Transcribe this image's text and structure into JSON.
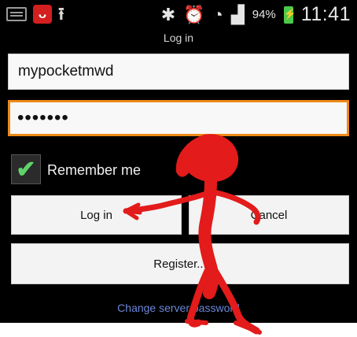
{
  "status_bar": {
    "icons": [
      "keyboard-icon",
      "avira-icon",
      "upload-icon",
      "bluetooth-icon",
      "alarm-icon",
      "wifi-icon",
      "signal-icon",
      "battery-charging-icon"
    ],
    "avira_glyph": "ᴗ",
    "upload_glyph": "⭱",
    "bluetooth_glyph": "✱",
    "alarm_glyph": "⏰",
    "wifi_glyph": "◔",
    "signal_glyph": "▟",
    "battery_percent": "94%",
    "time": "11:41"
  },
  "screen_title": "Log in",
  "username_value": "mypocketmwd",
  "password_value": "•••••••",
  "remember_me": {
    "label": "Remember me",
    "checked": true,
    "check_glyph": "✔"
  },
  "buttons": {
    "login": "Log in",
    "cancel": "Cancel",
    "register": "Register..."
  },
  "change_password_link": "Change server password",
  "colors": {
    "focus_border": "#ee8a17",
    "check": "#5fd36a",
    "link": "#6d86d8",
    "doodle": "#e31b1b"
  }
}
